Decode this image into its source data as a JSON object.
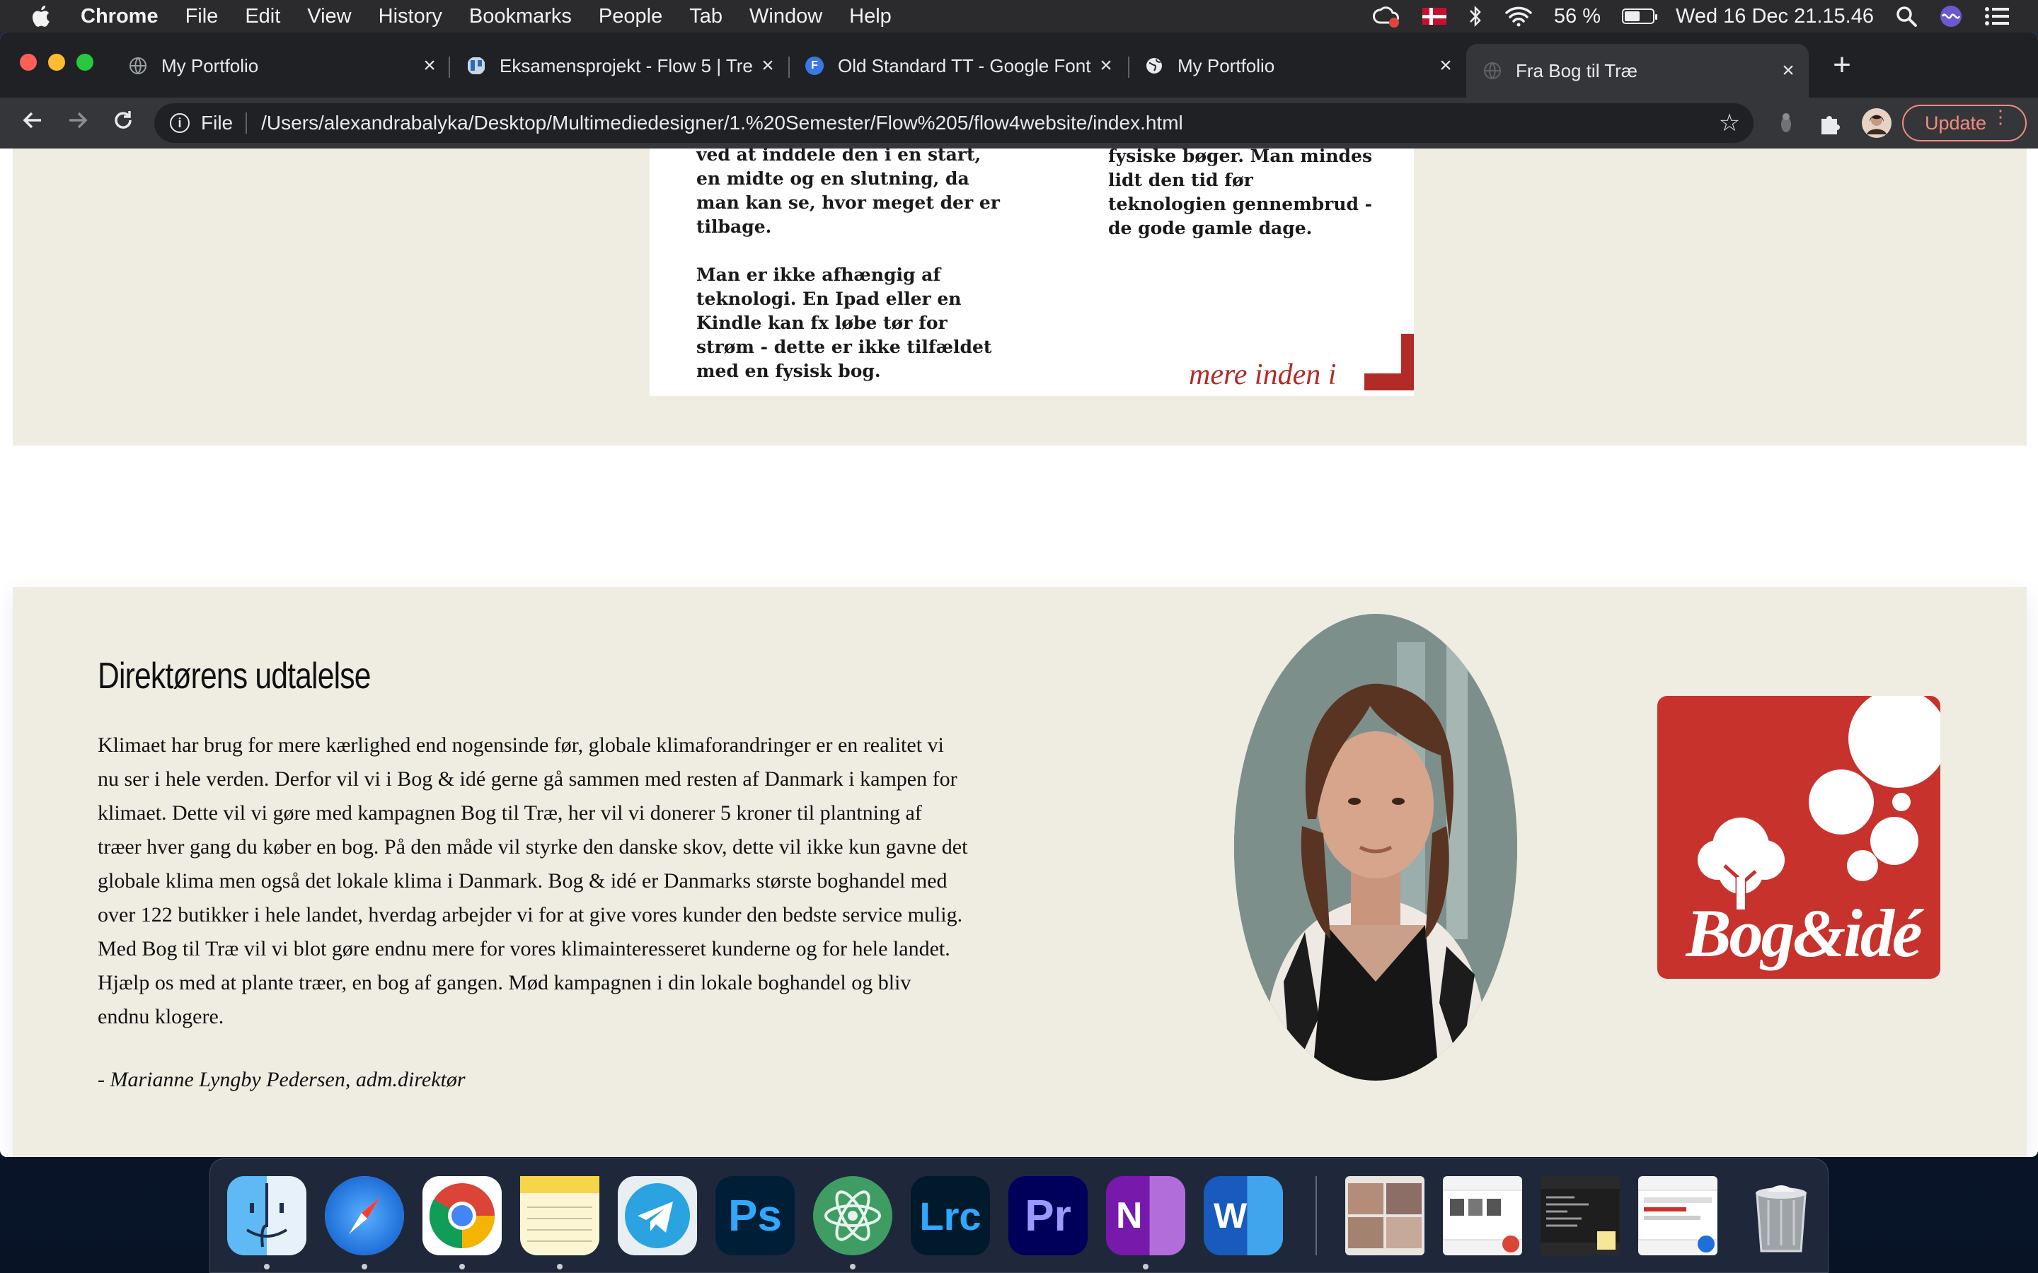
{
  "menubar": {
    "app_name": "Chrome",
    "items": [
      "File",
      "Edit",
      "View",
      "History",
      "Bookmarks",
      "People",
      "Tab",
      "Window",
      "Help"
    ],
    "battery_percent": "56 %",
    "battery_level": 0.56,
    "datetime": "Wed 16 Dec  21.15.46"
  },
  "browser": {
    "tabs": [
      {
        "title": "My Portfolio",
        "favicon": "globe-icon"
      },
      {
        "title": "Eksamensprojekt - Flow 5 | Tre",
        "favicon": "trello-icon"
      },
      {
        "title": "Old Standard TT - Google Font",
        "favicon": "google-fonts-icon",
        "favicon_letter": "F"
      },
      {
        "title": "My Portfolio",
        "favicon": "globe-icon"
      },
      {
        "title": "Fra Bog til Træ",
        "favicon": "globe-icon",
        "active": true
      }
    ],
    "address": {
      "scheme_label": "File",
      "url": "/Users/alexandrabalyka/Desktop/Multimediedesigner/1.%20Semester/Flow%205/flow4website/index.html"
    },
    "update_label": "Update"
  },
  "page": {
    "book_panel": {
      "left_col": [
        "ved at inddele den i en start, en midte og en slutning, da man kan se, hvor meget der er tilbage.",
        "Man er ikke afhængig af teknologi. En Ipad eller en Kindle kan fx løbe tør for strøm - dette er ikke tilfældet med en fysisk bog."
      ],
      "right_col": [
        "fysiske bøger. Man mindes lidt den tid før teknologien gennembrud - de gode gamle dage."
      ],
      "more_link": "mere inden i"
    },
    "director": {
      "heading": "Direktørens udtalelse",
      "statement": "Klimaet har brug for mere kærlighed end nogensinde før, globale klimaforandringer er en realitet vi nu ser i hele verden. Derfor vil vi i Bog & idé gerne gå sammen med resten af Danmark i kampen for klimaet. Dette vil vi gøre med kampagnen Bog til Træ, her vil vi donerer 5 kroner til plantning af træer hver gang du køber en bog. På den måde vil styrke den danske skov, dette vil ikke kun gavne det globale klima men også det lokale klima i Danmark. Bog & idé er Danmarks største boghandel med over 122 butikker i hele landet, hverdag arbejder vi for at give vores kunder den bedste service mulig. Med Bog til Træ vil vi blot gøre endnu mere for vores klimainteresseret kunderne og for hele landet. Hjælp os med at plante træer, en bog af gangen. Mød kampagnen i din lokale boghandel og bliv endnu klogere.",
      "signature": "- Marianne Lyngby Pedersen, adm.direktør",
      "logo_text": "Bog&idé"
    }
  },
  "dock": {
    "apps": [
      {
        "name": "finder-icon",
        "label": ""
      },
      {
        "name": "safari-icon",
        "label": ""
      },
      {
        "name": "chrome-icon",
        "label": ""
      },
      {
        "name": "notes-icon",
        "label": ""
      },
      {
        "name": "telegram-icon",
        "label": ""
      },
      {
        "name": "photoshop-icon",
        "label": "Ps"
      },
      {
        "name": "atom-icon",
        "label": ""
      },
      {
        "name": "lightroom-classic-icon",
        "label": "Lrc"
      },
      {
        "name": "premiere-pro-icon",
        "label": "Pr"
      },
      {
        "name": "onenote-icon",
        "label": "N"
      },
      {
        "name": "word-icon",
        "label": "W"
      }
    ],
    "colors": {
      "photoshop": "#001e36",
      "lightroom": "#001a2b",
      "premiere": "#00005b",
      "onenote": "#7719aa",
      "word": "#185abd",
      "accent_red": "#c8322c"
    }
  }
}
